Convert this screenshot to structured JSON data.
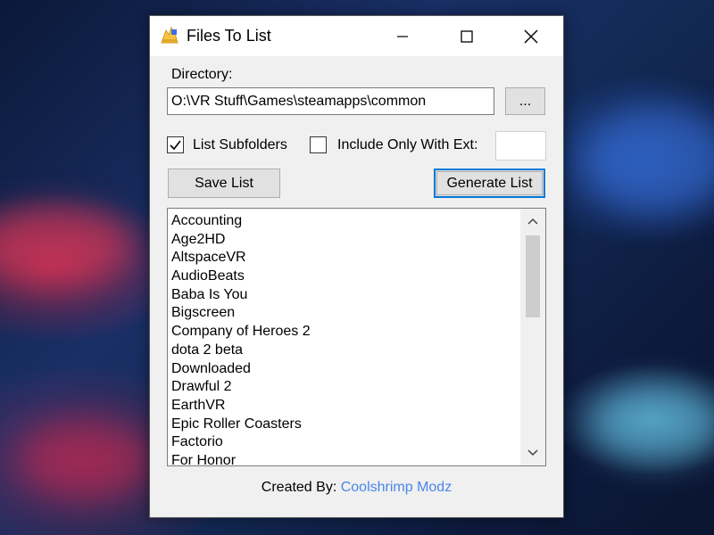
{
  "window": {
    "title": "Files To List"
  },
  "form": {
    "directory_label": "Directory:",
    "directory_value": "O:\\VR Stuff\\Games\\steamapps\\common",
    "browse_label": "...",
    "list_subfolders_label": "List Subfolders",
    "list_subfolders_checked": true,
    "include_ext_label": "Include Only With Ext:",
    "include_ext_checked": false,
    "ext_value": "",
    "save_label": "Save List",
    "generate_label": "Generate List"
  },
  "list": {
    "items": [
      "Accounting",
      "Age2HD",
      "AltspaceVR",
      "AudioBeats",
      "Baba Is You",
      "Bigscreen",
      "Company of Heroes 2",
      "dota 2 beta",
      "Downloaded",
      "Drawful 2",
      "EarthVR",
      "Epic Roller Coasters",
      "Factorio",
      "For Honor"
    ]
  },
  "footer": {
    "created_by_label": "Created By:",
    "author": "Coolshrimp Modz"
  },
  "colors": {
    "accent": "#0078d7",
    "link": "#4a86e8",
    "window_bg": "#f0f0f0"
  },
  "icons": {
    "app": "folder-flame-icon",
    "minimize": "minimize-icon",
    "maximize": "maximize-icon",
    "close": "close-icon",
    "scroll_up": "chevron-up-icon",
    "scroll_down": "chevron-down-icon",
    "check": "checkmark-icon"
  }
}
